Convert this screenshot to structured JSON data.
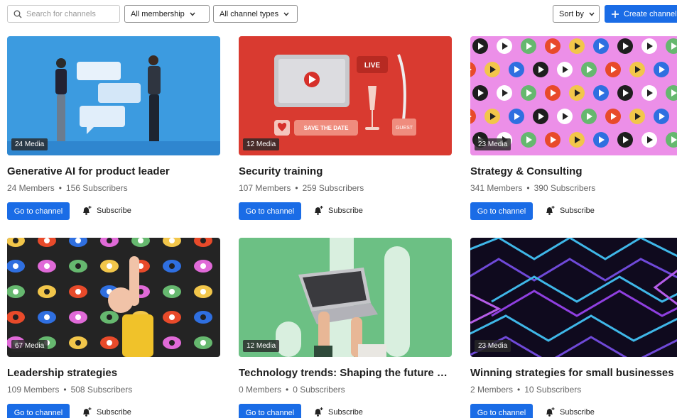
{
  "toolbar": {
    "search_placeholder": "Search for channels",
    "membership_filter": "All membership",
    "type_filter": "All channel types",
    "sort_label": "Sort by",
    "create_label": "Create channel"
  },
  "colors": {
    "primary": "#1a6ce6",
    "badge_bg": "#282828"
  },
  "action_labels": {
    "go": "Go to channel",
    "subscribe": "Subscribe"
  },
  "channels": [
    {
      "title": "Generative AI for product leader",
      "members": "24 Members",
      "subscribers": "156 Subscribers",
      "media": "24 Media",
      "go": "Go to channel",
      "subscribe": "Subscribe"
    },
    {
      "title": "Security training",
      "members": "107 Members",
      "subscribers": "259 Subscribers",
      "media": "12 Media",
      "go": "Go to channel",
      "subscribe": "Subscribe",
      "thumb_text": {
        "live": "LIVE",
        "save_date": "SAVE THE DATE",
        "guest": "GUEST"
      }
    },
    {
      "title": "Strategy & Consulting",
      "members": "341 Members",
      "subscribers": "390 Subscribers",
      "media": "23 Media",
      "go": "Go to channel",
      "subscribe": "Subscribe"
    },
    {
      "title": "Leadership strategies",
      "members": "109 Members",
      "subscribers": "508 Subscribers",
      "media": "67 Media",
      "go": "Go to channel",
      "subscribe": "Subscribe"
    },
    {
      "title": "Technology trends: Shaping the future en...",
      "members": "0 Members",
      "subscribers": "0 Subscribers",
      "media": "12 Media",
      "go": "Go to channel",
      "subscribe": "Subscribe"
    },
    {
      "title": "Winning strategies for small businesses",
      "members": "2 Members",
      "subscribers": "10 Subscribers",
      "media": "23 Media",
      "go": "Go to channel",
      "subscribe": "Subscribe"
    }
  ]
}
